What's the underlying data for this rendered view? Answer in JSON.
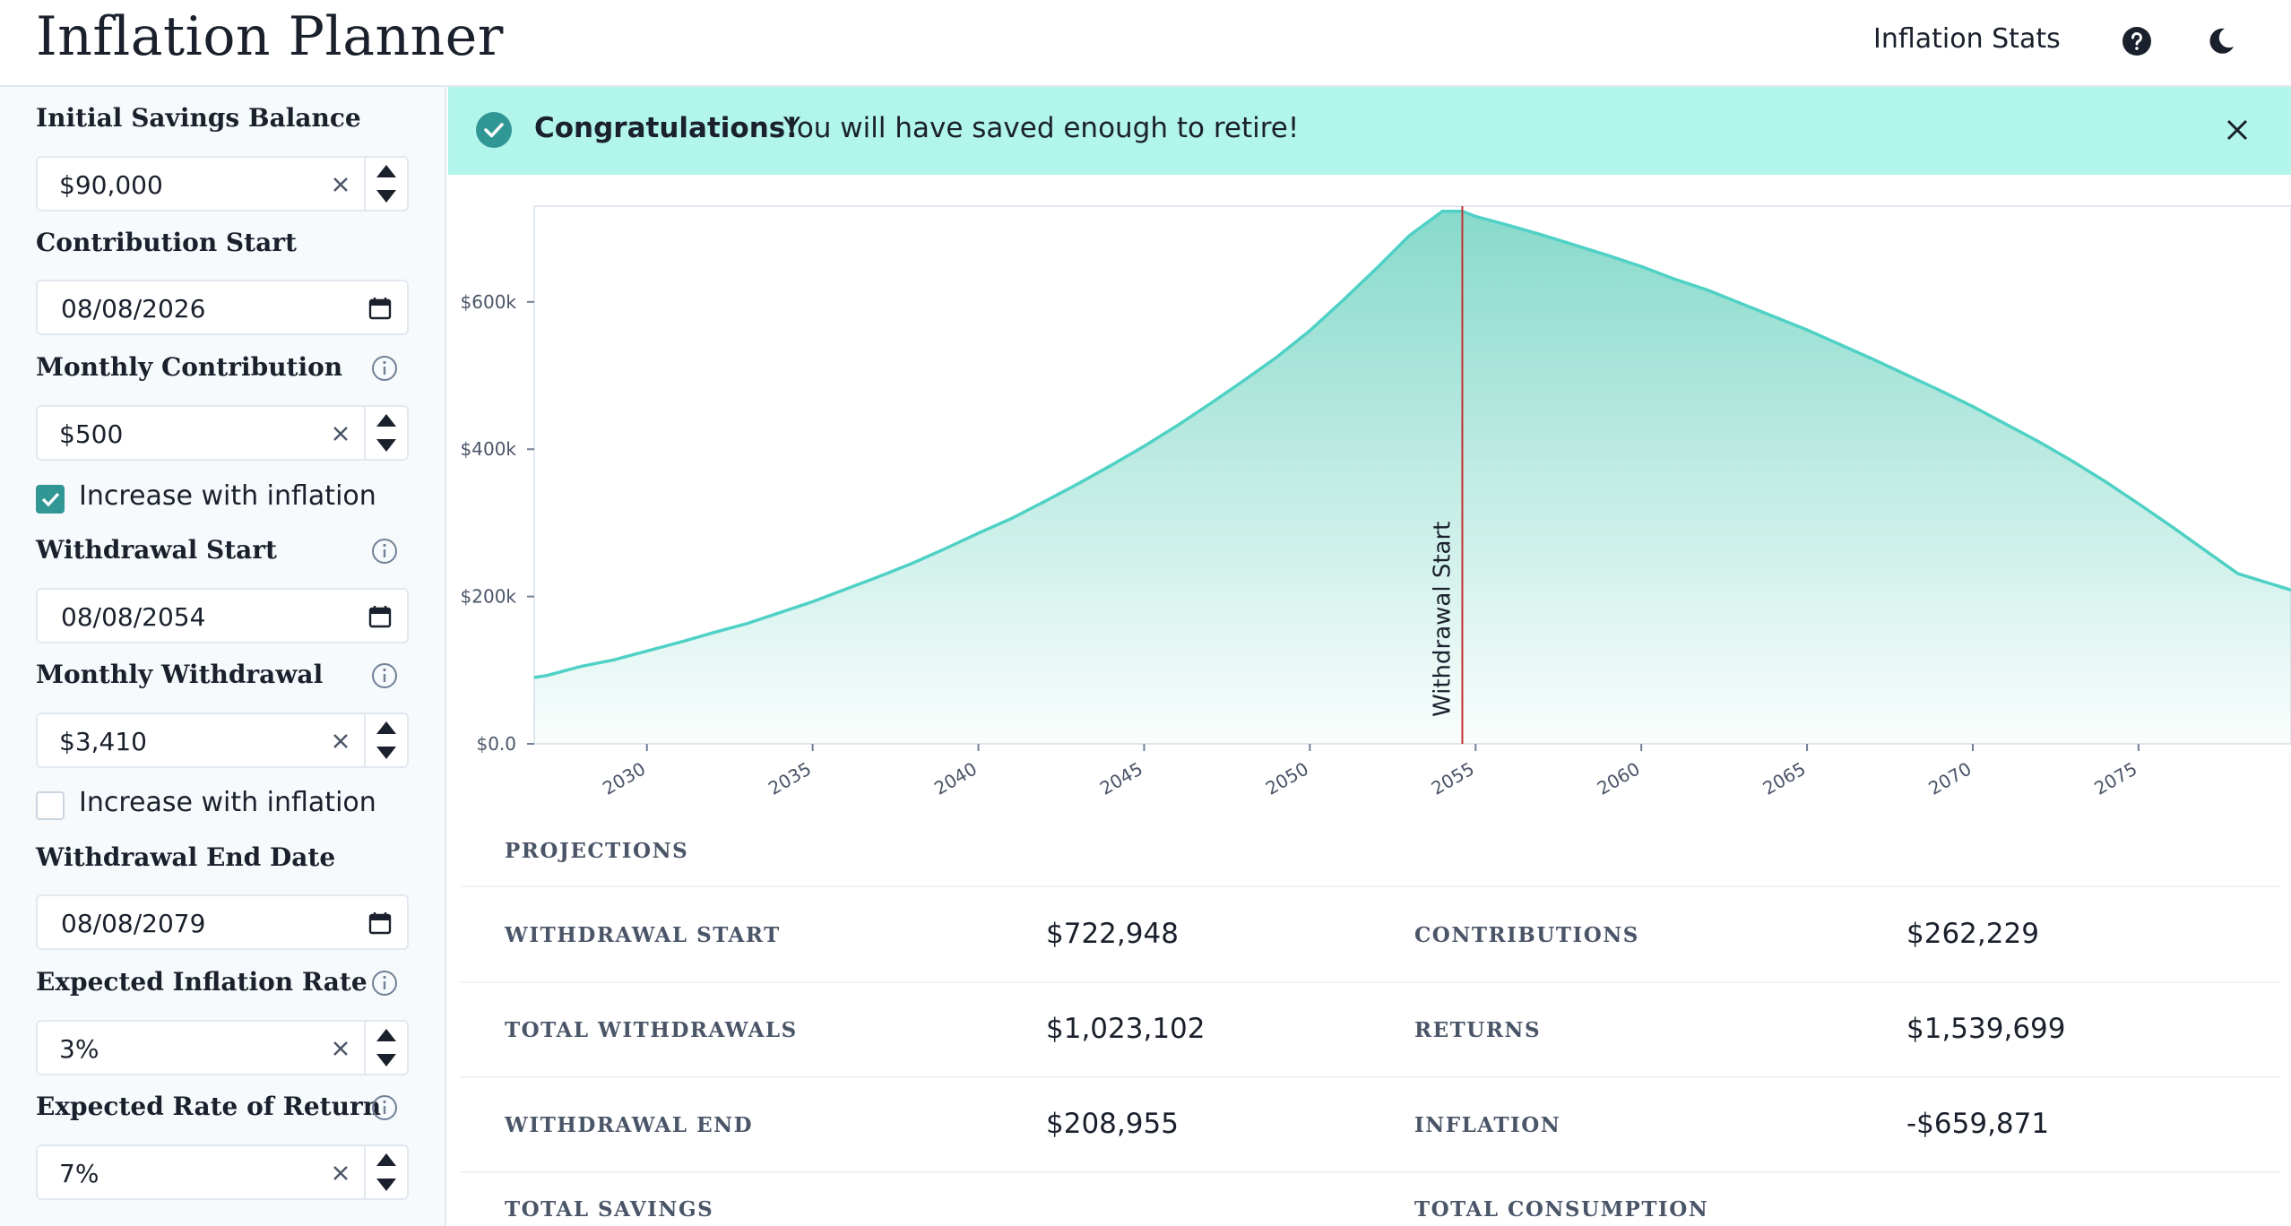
{
  "header": {
    "title": "Inflation Planner",
    "nav_link": "Inflation Stats",
    "icons": [
      "help-icon",
      "moon-icon"
    ]
  },
  "sidebar": {
    "initial_savings": {
      "label": "Initial Savings Balance",
      "value": "$90,000"
    },
    "contribution_start": {
      "label": "Contribution Start",
      "value": "08/08/2026"
    },
    "monthly_contribution": {
      "label": "Monthly Contribution",
      "value": "$500"
    },
    "contribution_inflation": {
      "label": "Increase with inflation",
      "checked": true
    },
    "withdrawal_start": {
      "label": "Withdrawal Start",
      "value": "08/08/2054"
    },
    "monthly_withdrawal": {
      "label": "Monthly Withdrawal",
      "value": "$3,410"
    },
    "withdrawal_inflation": {
      "label": "Increase with inflation",
      "checked": false
    },
    "withdrawal_end": {
      "label": "Withdrawal End Date",
      "value": "08/08/2079"
    },
    "inflation_rate": {
      "label": "Expected Inflation Rate",
      "value": "3%"
    },
    "rate_of_return": {
      "label": "Expected Rate of Return",
      "value": "7%"
    }
  },
  "alert": {
    "title": "Congratulations!",
    "message": "You will have saved enough to retire!"
  },
  "colors": {
    "accent": "#319795",
    "alert_bg": "#b2f5ea",
    "line": "#4fd1c5",
    "marker": "#c53030"
  },
  "chart_data": {
    "type": "area",
    "x": [
      2026.6,
      2027,
      2028,
      2029,
      2030,
      2031,
      2032,
      2033,
      2034,
      2035,
      2036,
      2037,
      2038,
      2039,
      2040,
      2041,
      2042,
      2043,
      2044,
      2045,
      2046,
      2047,
      2048,
      2049,
      2050,
      2051,
      2052,
      2053,
      2054,
      2054.6,
      2055,
      2056,
      2057,
      2058,
      2059,
      2060,
      2061,
      2062,
      2063,
      2064,
      2065,
      2066,
      2067,
      2068,
      2069,
      2070,
      2071,
      2072,
      2073,
      2074,
      2075,
      2076,
      2077,
      2078,
      2079.6
    ],
    "y": [
      90000,
      93000,
      105000,
      114000,
      126000,
      138000,
      151000,
      163000,
      178000,
      193000,
      210000,
      227000,
      245000,
      265000,
      286000,
      306000,
      329000,
      353000,
      378000,
      404000,
      432000,
      462000,
      493000,
      525000,
      561000,
      602000,
      645000,
      690000,
      722948,
      722948,
      716000,
      704000,
      691000,
      677000,
      663000,
      648000,
      631000,
      616000,
      598000,
      580000,
      562000,
      542000,
      522000,
      501000,
      480000,
      458000,
      434000,
      410000,
      384000,
      356000,
      326000,
      295000,
      263000,
      231000,
      208955
    ],
    "xticks": [
      "2030",
      "2035",
      "2040",
      "2045",
      "2050",
      "2055",
      "2060",
      "2065",
      "2070",
      "2075"
    ],
    "yticks": [
      "$0.0",
      "$200k",
      "$400k",
      "$600k"
    ],
    "xlim": [
      2026.6,
      2079.6
    ],
    "ylim": [
      0,
      730000
    ],
    "annotation": {
      "label": "Withdrawal Start",
      "x": 2054.6
    },
    "grid": false
  },
  "projections": {
    "heading": "PROJECTIONS",
    "rows": [
      {
        "l1": "WITHDRAWAL START",
        "v1": "$722,948",
        "l2": "CONTRIBUTIONS",
        "v2": "$262,229"
      },
      {
        "l1": "TOTAL WITHDRAWALS",
        "v1": "$1,023,102",
        "l2": "RETURNS",
        "v2": "$1,539,699"
      },
      {
        "l1": "WITHDRAWAL END",
        "v1": "$208,955",
        "l2": "INFLATION",
        "v2": "-$659,871"
      },
      {
        "l1": "TOTAL SAVINGS",
        "v1": "",
        "l2": "TOTAL CONSUMPTION",
        "v2": ""
      }
    ]
  }
}
